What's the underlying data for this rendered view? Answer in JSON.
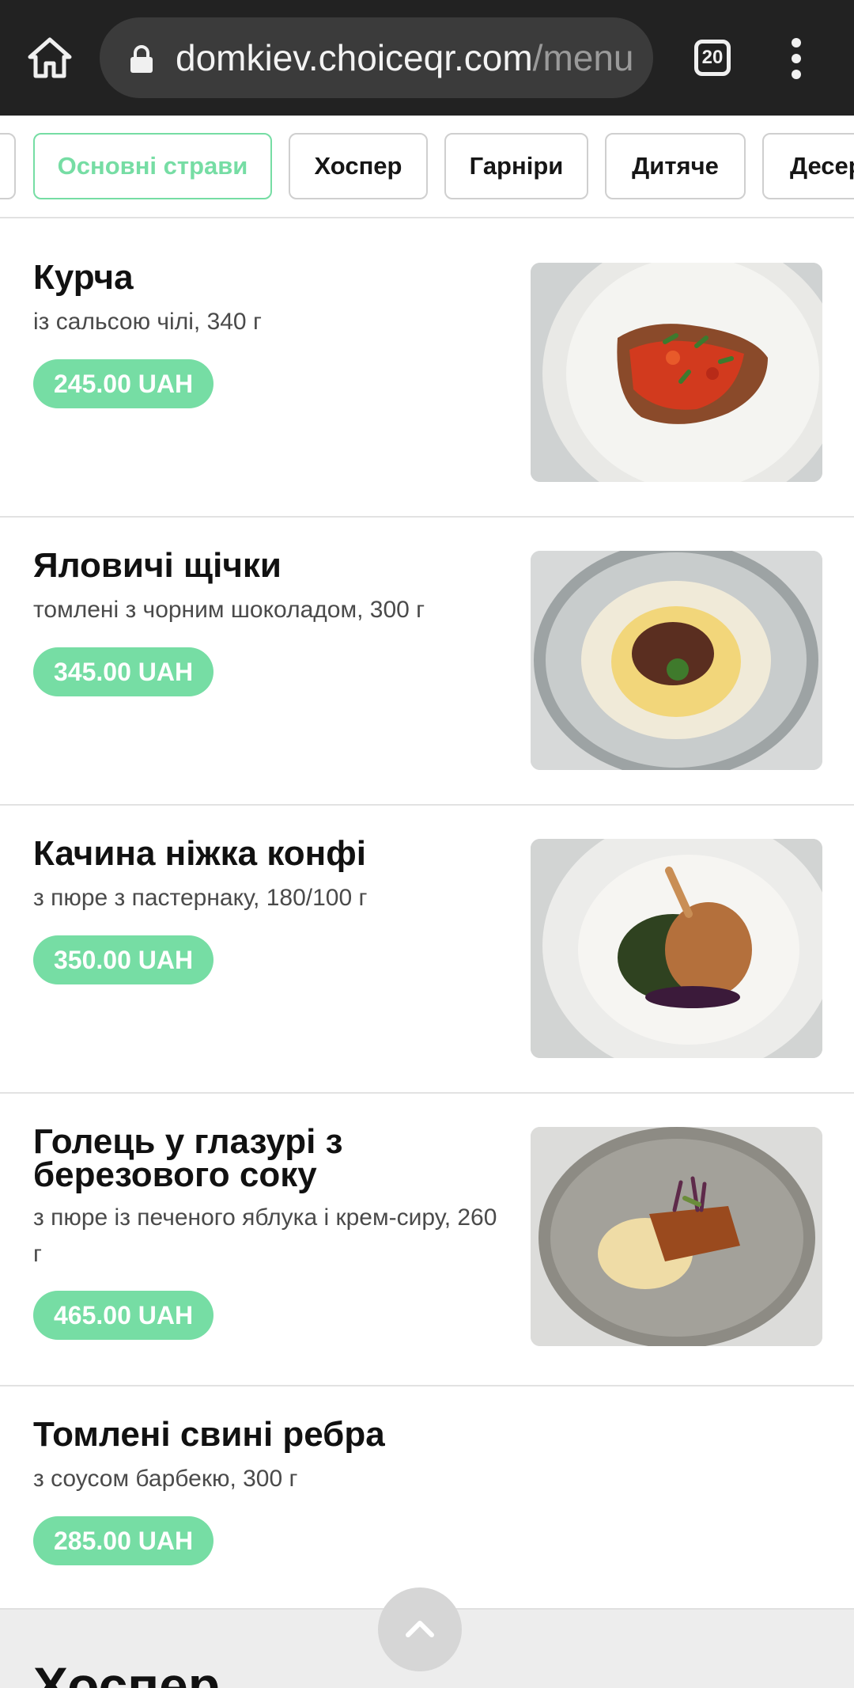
{
  "browser": {
    "url_domain": "domkiev.choiceqr.com",
    "url_path": "/menu",
    "tab_count": "20"
  },
  "categories": [
    {
      "label": "Основні страви",
      "active": true
    },
    {
      "label": "Хоспер",
      "active": false
    },
    {
      "label": "Гарніри",
      "active": false
    },
    {
      "label": "Дитяче",
      "active": false
    },
    {
      "label": "Десер",
      "active": false
    }
  ],
  "items": [
    {
      "name": "Курча",
      "desc": "із сальсою чілі, 340 г",
      "price": "245.00 UAH",
      "photo": "grilled-chicken-photo"
    },
    {
      "name": "Яловичі щічки",
      "desc": "томлені з чорним шоколадом, 300 г",
      "price": "345.00 UAH",
      "photo": "beef-cheeks-photo"
    },
    {
      "name": "Качина ніжка конфі",
      "desc": "з пюре з пастернаку, 180/100 г",
      "price": "350.00 UAH",
      "photo": "duck-confit-photo"
    },
    {
      "name": "Голець у глазурі з березового соку",
      "desc": "з пюре із печеного яблука і крем-сиру, 260 г",
      "price": "465.00 UAH",
      "photo": "char-fish-photo"
    },
    {
      "name": "Томлені свині ребра",
      "desc": "з соусом барбекю, 300 г",
      "price": "285.00 UAH"
    }
  ],
  "next_section": "Хоспер",
  "colors": {
    "accent": "#76dda4",
    "browser_bar": "#222222",
    "text": "#111111"
  },
  "icons": {
    "home": "home-icon",
    "lock": "lock-icon",
    "tabs": "tabs-icon",
    "menu": "more-vert-icon",
    "scroll_top": "chevron-up-icon"
  }
}
